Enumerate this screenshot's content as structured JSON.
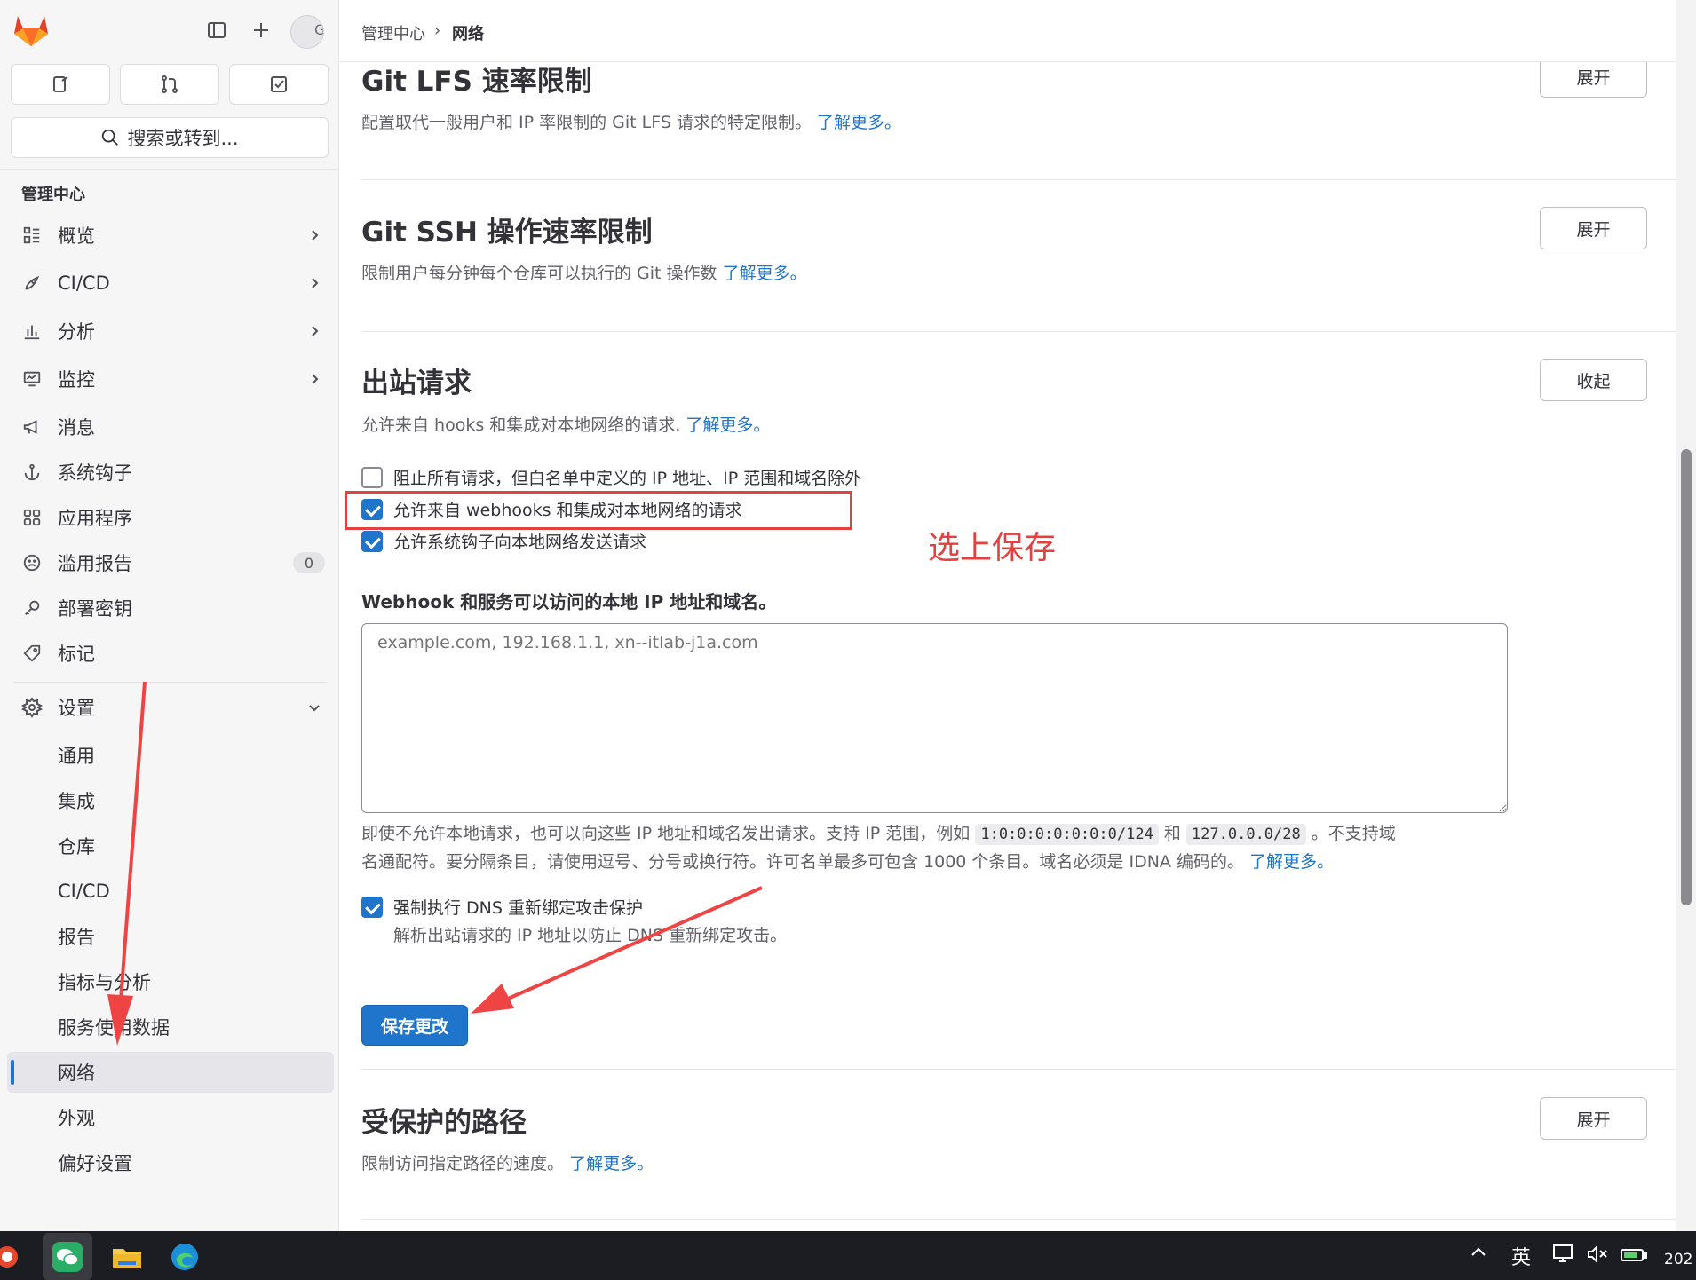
{
  "breadcrumb": {
    "parent": "管理中心",
    "current": "网络"
  },
  "sidebar": {
    "search_label": "搜索或转到...",
    "section_title": "管理中心",
    "items": [
      {
        "label": "概览"
      },
      {
        "label": "CI/CD"
      },
      {
        "label": "分析"
      },
      {
        "label": "监控"
      },
      {
        "label": "消息"
      },
      {
        "label": "系统钩子"
      },
      {
        "label": "应用程序"
      },
      {
        "label": "滥用报告",
        "badge": "0"
      },
      {
        "label": "部署密钥"
      },
      {
        "label": "标记"
      }
    ],
    "settings": {
      "label": "设置",
      "subitems": [
        {
          "label": "通用"
        },
        {
          "label": "集成"
        },
        {
          "label": "仓库"
        },
        {
          "label": "CI/CD"
        },
        {
          "label": "报告"
        },
        {
          "label": "指标与分析"
        },
        {
          "label": "服务使用数据"
        },
        {
          "label": "网络"
        },
        {
          "label": "外观"
        },
        {
          "label": "偏好设置"
        }
      ]
    }
  },
  "sections": {
    "lfs": {
      "title": "Git LFS 速率限制",
      "desc": "配置取代一般用户和 IP 率限制的 Git LFS 请求的特定限制。",
      "link": "了解更多。",
      "button": "展开"
    },
    "ssh": {
      "title": "Git SSH 操作速率限制",
      "desc": "限制用户每分钟每个仓库可以执行的 Git 操作数",
      "link": "了解更多。",
      "button": "展开"
    },
    "outbound": {
      "title": "出站请求",
      "desc": "允许来自 hooks 和集成对本地网络的请求.",
      "link": "了解更多。",
      "button": "收起",
      "checkboxes": [
        {
          "label": "阻止所有请求，但白名单中定义的 IP 地址、IP 范围和域名除外",
          "checked": false
        },
        {
          "label": "允许来自 webhooks 和集成对本地网络的请求",
          "checked": true
        },
        {
          "label": "允许系统钩子向本地网络发送请求",
          "checked": true
        }
      ],
      "allowlist_label": "Webhook 和服务可以访问的本地 IP 地址和域名。",
      "allowlist_placeholder": "example.com, 192.168.1.1, xn--itlab-j1a.com",
      "help_part1": "即使不允许本地请求，也可以向这些 IP 地址和域名发出请求。支持 IP 范围，例如",
      "code1": "1:0:0:0:0:0:0:0/124",
      "help_and": "和",
      "code2": "127.0.0.0/28",
      "help_part2": "。不支持域",
      "help_line2": "名通配符。要分隔条目，请使用逗号、分号或换行符。许可名单最多可包含 1000 个条目。域名必须是 IDNA 编码的。",
      "help_link": "了解更多。",
      "dns_label": "强制执行 DNS 重新绑定攻击保护",
      "dns_checked": true,
      "dns_help": "解析出站请求的 IP 地址以防止 DNS 重新绑定攻击。",
      "save_button": "保存更改"
    },
    "protected": {
      "title": "受保护的路径",
      "desc": "限制访问指定路径的速度。",
      "link": "了解更多。",
      "button": "展开"
    }
  },
  "annotation": {
    "text": "选上保存",
    "color": "#e2413f"
  },
  "taskbar": {
    "ime": "英",
    "clock_fragment": "202"
  },
  "colors": {
    "accent": "#1f75cb",
    "annotation": "#e2413f"
  }
}
